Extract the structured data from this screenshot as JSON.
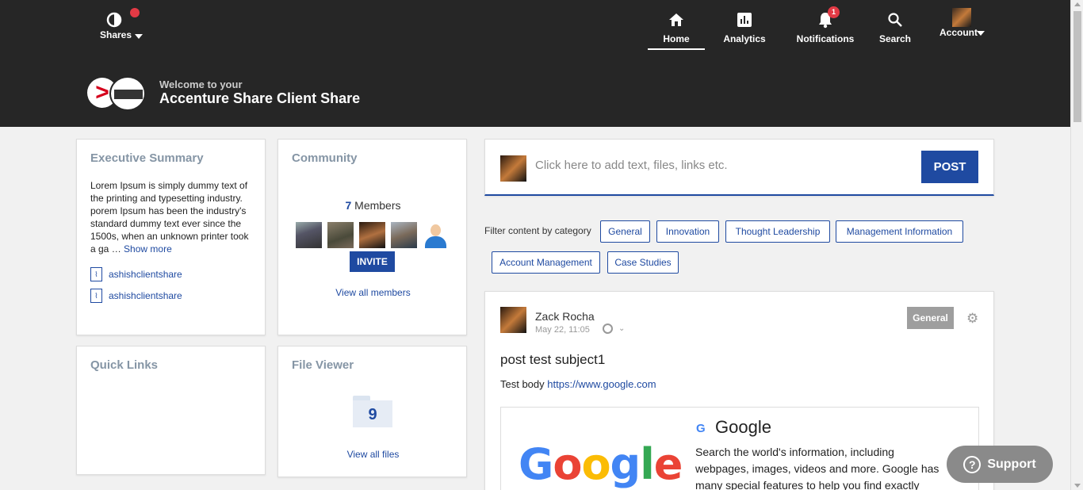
{
  "nav": {
    "shares_label": "Shares",
    "home_label": "Home",
    "analytics_label": "Analytics",
    "notifications_label": "Notifications",
    "notifications_count": "1",
    "search_label": "Search",
    "account_label": "Account"
  },
  "header": {
    "welcome_small": "Welcome to your",
    "welcome_big": "Accenture Share Client Share"
  },
  "executive_summary": {
    "title": "Executive Summary",
    "body": "Lorem Ipsum is simply dummy text of the printing and typesetting industry. porem Ipsum has been the industry's standard dummy text ever since the 1500s, when an unknown printer took a ga …",
    "show_more": "Show more",
    "files": [
      "ashishclientshare",
      "ashishclientshare"
    ]
  },
  "community": {
    "title": "Community",
    "member_count": "7",
    "members_label": "Members",
    "invite_label": "INVITE",
    "view_all": "View all members"
  },
  "quick_links": {
    "title": "Quick Links"
  },
  "file_viewer": {
    "title": "File Viewer",
    "file_count": "9",
    "view_all": "View all files"
  },
  "composer": {
    "placeholder": "Click here to add text, files, links etc.",
    "post_label": "POST"
  },
  "filter": {
    "label": "Filter content by category",
    "categories": [
      "General",
      "Innovation",
      "Thought Leadership",
      "Management Information",
      "Account Management",
      "Case Studies"
    ]
  },
  "post": {
    "author": "Zack Rocha",
    "time": "May 22, 11:05",
    "category": "General",
    "subject": "post test subject1",
    "body_prefix": "Test body",
    "link": "https://www.google.com",
    "preview_title": "Google",
    "preview_desc": "Search the world's information, including webpages, images, videos and more. Google has many special features to help you find exactly",
    "preview_logo": [
      "G",
      "o",
      "o",
      "g",
      "l",
      "e"
    ]
  },
  "support_label": "Support",
  "colors": {
    "accent": "#1f4aa1",
    "topbar": "#262626",
    "badge": "#e33a45"
  }
}
